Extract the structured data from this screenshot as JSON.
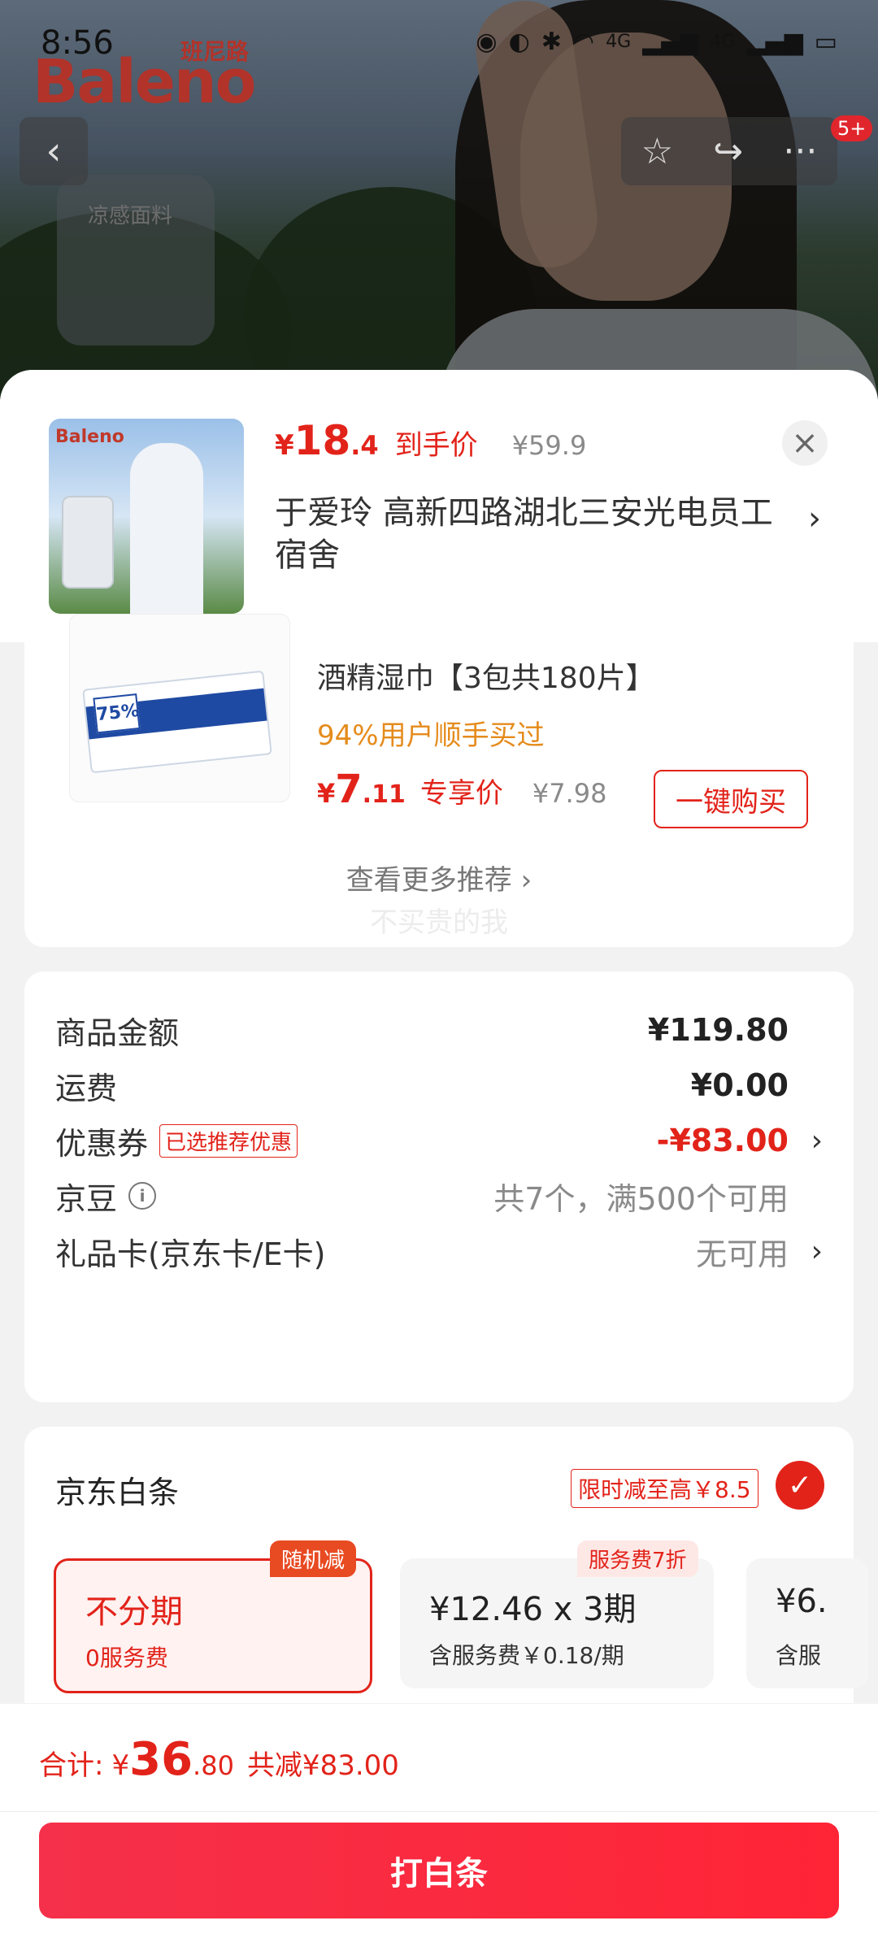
{
  "status_bar": {
    "time": "8:56",
    "signal_1": "4G",
    "signal_2": "4G"
  },
  "hero": {
    "brand": "Baleno",
    "brand_cn": "班尼路",
    "phone_label": "凉感面料",
    "notification_badge": "5+"
  },
  "sheet": {
    "price_currency": "¥",
    "price_int": "18",
    "price_dec": ".4",
    "price_tag": "到手价",
    "price_orig": "¥59.9",
    "address": "于爱玲  高新四路湖北三安光电员工宿舍",
    "thumb_logo": "Baleno"
  },
  "recommend": {
    "name": "酒精湿巾【3包共180片】",
    "hint": "94%用户顺手买过",
    "currency": "¥",
    "price_int": "7",
    "price_dec": ".11",
    "price_tag": "专享价",
    "orig": "¥7.98",
    "buy": "一键购买",
    "more": "查看更多推荐 ›",
    "watermark": "不买贵的我",
    "wipe_pct": "75%"
  },
  "summary": {
    "goods_label": "商品金额",
    "goods_value": "¥119.80",
    "ship_label": "运费",
    "ship_value": "¥0.00",
    "coupon_label": "优惠券",
    "coupon_tag": "已选推荐优惠",
    "coupon_value": "-¥83.00",
    "bean_label": "京豆",
    "bean_value": "共7个，满500个可用",
    "gift_label": "礼品卡(京东卡/E卡)",
    "gift_value": "无可用"
  },
  "payment": {
    "title": "京东白条",
    "promo": "限时减至高￥8.5",
    "plans": [
      {
        "tag": "随机减",
        "title": "不分期",
        "sub": "0服务费"
      },
      {
        "tag": "服务费7折",
        "title": "¥12.46 x 3期",
        "sub": "含服务费￥0.18/期"
      },
      {
        "tag": "",
        "title": "¥6.",
        "sub": "含服"
      }
    ]
  },
  "footer": {
    "total_label": "合计:",
    "currency": "¥",
    "total_int": "36",
    "total_dec": ".80",
    "discount": "共减¥83.00",
    "cta": "打白条"
  },
  "colors": {
    "accent": "#e2231a",
    "warn": "#e58b1c",
    "cta": "#ff2436"
  }
}
